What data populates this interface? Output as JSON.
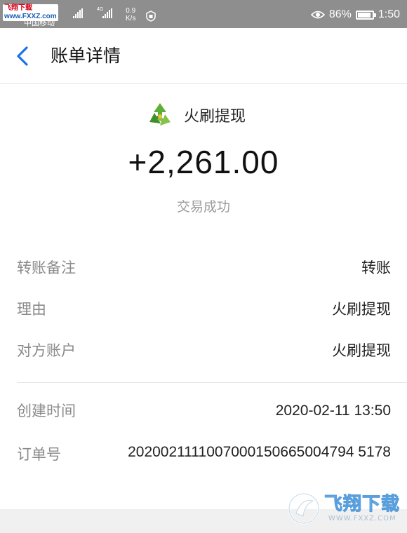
{
  "status_bar": {
    "site_logo_part1": "飞翔下载",
    "site_logo_part2": "www.FXXZ.com",
    "carrier": "中国移动",
    "network_tag": "4G",
    "speed_value": "0.9",
    "speed_unit": "K/s",
    "battery_percent": "86%",
    "time": "1:50"
  },
  "app_bar": {
    "back_icon": "chevron-left-icon",
    "title": "账单详情"
  },
  "transaction": {
    "merchant_name": "火刷提现",
    "merchant_icon": "recycle-logo-icon",
    "amount": "+2,261.00",
    "status": "交易成功"
  },
  "details": [
    {
      "label": "转账备注",
      "value": "转账"
    },
    {
      "label": "理由",
      "value": "火刷提现"
    },
    {
      "label": "对方账户",
      "value": "火刷提现"
    }
  ],
  "meta": [
    {
      "label": "创建时间",
      "value": "2020-02-11 13:50"
    },
    {
      "label": "订单号",
      "value": "2020021111007000150665004794 5178"
    }
  ],
  "watermark": {
    "brand": "飞翔下载",
    "url": "WWW.FXXZ.COM"
  },
  "colors": {
    "status_bar": "#8e8e8e",
    "back_icon": "#1a73e8",
    "label_gray": "#8a8a8a",
    "text_dark": "#222222"
  }
}
